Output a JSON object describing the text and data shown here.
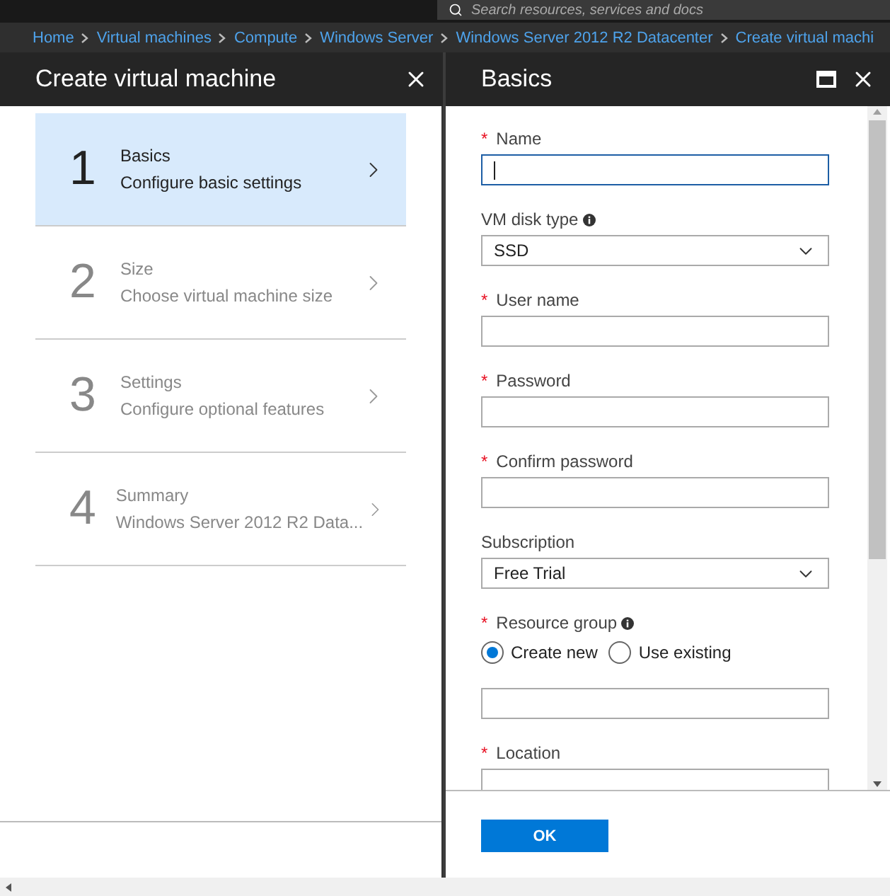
{
  "top_bar": {
    "search": {
      "placeholder": "Search resources, services and docs"
    }
  },
  "breadcrumb": [
    "Home",
    "Virtual machines",
    "Compute",
    "Windows Server",
    "Windows Server 2012 R2 Datacenter",
    "Create virtual machi"
  ],
  "left_blade": {
    "title": "Create virtual machine",
    "steps": [
      {
        "number": "1",
        "title": "Basics",
        "subtitle": "Configure basic settings",
        "selected": true
      },
      {
        "number": "2",
        "title": "Size",
        "subtitle": "Choose virtual machine size",
        "selected": false
      },
      {
        "number": "3",
        "title": "Settings",
        "subtitle": "Configure optional features",
        "selected": false
      },
      {
        "number": "4",
        "title": "Summary",
        "subtitle": "Windows Server 2012 R2 Data...",
        "selected": false
      }
    ]
  },
  "right_blade": {
    "title": "Basics",
    "fields": [
      {
        "kind": "text",
        "label": "Name",
        "required_mark": "*",
        "focused": true
      },
      {
        "kind": "select",
        "label": "VM disk type",
        "info": true,
        "value": "SSD"
      },
      {
        "kind": "text",
        "label": "User name",
        "required_mark": "*",
        "focused": false
      },
      {
        "kind": "text",
        "label": "Password",
        "required_mark": "*",
        "focused": false
      },
      {
        "kind": "text",
        "label": "Confirm password",
        "required_mark": "*",
        "focused": false
      },
      {
        "kind": "select",
        "label": "Subscription",
        "value": "Free Trial"
      },
      {
        "kind": "radio",
        "label": "Resource group",
        "required_mark": "*",
        "info": true,
        "options": [
          {
            "label": "Create new",
            "selected": true
          },
          {
            "label": "Use existing",
            "selected": false
          }
        ]
      },
      {
        "kind": "text",
        "focused": false
      },
      {
        "kind": "text",
        "label": "Location",
        "required_mark": "*",
        "focused": false
      }
    ],
    "ok_button": "OK"
  }
}
